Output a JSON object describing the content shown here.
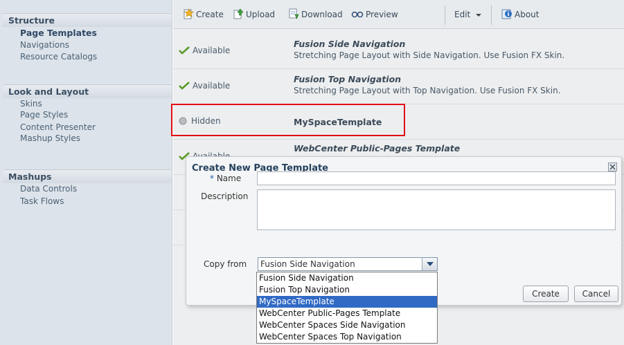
{
  "sidebar": {
    "groups": [
      {
        "title": "Structure",
        "items": [
          "Page Templates",
          "Navigations",
          "Resource Catalogs"
        ],
        "selected": 0
      },
      {
        "title": "Look and Layout",
        "items": [
          "Skins",
          "Page Styles",
          "Content Presenter",
          "Mashup Styles"
        ]
      },
      {
        "title": "Mashups",
        "items": [
          "Data Controls",
          "Task Flows"
        ]
      }
    ]
  },
  "toolbar": {
    "create": "Create",
    "upload": "Upload",
    "download": "Download",
    "preview": "Preview",
    "edit": "Edit",
    "about": "About"
  },
  "list": {
    "rows": [
      {
        "status": "Available",
        "name": "Fusion Side Navigation",
        "desc": "Stretching Page Layout with Side Navigation. Use Fusion FX Skin."
      },
      {
        "status": "Available",
        "name": "Fusion Top Navigation",
        "desc": "Stretching Page Layout with Top Navigation. Use Fusion FX Skin."
      },
      {
        "status": "Hidden",
        "name": "MySpaceTemplate",
        "desc": ""
      },
      {
        "status": "Available",
        "name": "WebCenter Public-Pages Template",
        "desc": ""
      }
    ]
  },
  "dialog": {
    "title": "Create New Page Template",
    "required_mark": "*",
    "name_label": "Name",
    "name_value": "",
    "description_label": "Description",
    "description_value": "",
    "copy_from_label": "Copy from",
    "copy_from_value": "Fusion Side Navigation",
    "create_button": "Create",
    "cancel_button": "Cancel",
    "options": [
      "Fusion Side Navigation",
      "Fusion Top Navigation",
      "MySpaceTemplate",
      "WebCenter Public-Pages Template",
      "WebCenter Spaces Side Navigation",
      "WebCenter Spaces Top Navigation"
    ],
    "highlighted_option": 2
  },
  "colors": {
    "accent_blue": "#316ac5",
    "highlight_red": "#e10d15",
    "available_green": "#5a9a2a"
  }
}
